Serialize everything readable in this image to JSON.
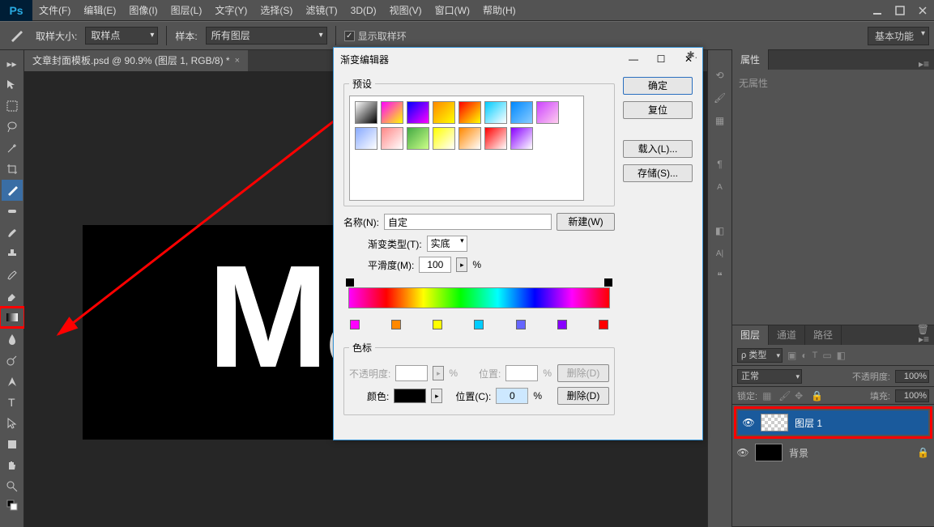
{
  "app": {
    "logo": "Ps"
  },
  "menu": [
    "文件(F)",
    "编辑(E)",
    "图像(I)",
    "图层(L)",
    "文字(Y)",
    "选择(S)",
    "滤镜(T)",
    "3D(D)",
    "视图(V)",
    "窗口(W)",
    "帮助(H)"
  ],
  "optbar": {
    "sample_size_label": "取样大小:",
    "sample_size_value": "取样点",
    "sample_label": "样本:",
    "sample_value": "所有图层",
    "show_ring_label": "显示取样环"
  },
  "workspace": "基本功能",
  "doc_tab": "文章封面模板.psd @ 90.9% (图层 1, RGB/8) *",
  "canvas_text": "Ma",
  "properties_panel": {
    "tab": "属性",
    "body": "无属性"
  },
  "layers_panel": {
    "tabs": [
      "图层",
      "通道",
      "路径"
    ],
    "kind": "ρ 类型",
    "blend": "正常",
    "opacity_label": "不透明度:",
    "opacity_value": "100%",
    "lock_label": "锁定:",
    "fill_label": "填充:",
    "fill_value": "100%",
    "layers": [
      {
        "name": "图层 1",
        "selected": true,
        "thumb": "checker"
      },
      {
        "name": "背景",
        "selected": false,
        "thumb": "black",
        "locked": true
      }
    ]
  },
  "dialog": {
    "title": "渐变编辑器",
    "presets_label": "预设",
    "ok": "确定",
    "reset": "复位",
    "load": "载入(L)...",
    "save": "存储(S)...",
    "name_label": "名称(N):",
    "name_value": "自定",
    "new_btn": "新建(W)",
    "grad_type_label": "渐变类型(T):",
    "grad_type_value": "实底",
    "smooth_label": "平滑度(M):",
    "smooth_value": "100",
    "pct": "%",
    "stops_label": "色标",
    "opacity_label": "不透明度:",
    "position_label": "位置:",
    "position2_label": "位置(C):",
    "position2_value": "0",
    "delete_btn": "删除(D)",
    "color_label": "颜色:",
    "swatches": [
      "linear-gradient(135deg,#fff,#000)",
      "linear-gradient(135deg,#f0f,#ff0)",
      "linear-gradient(135deg,#00f,#f0f)",
      "linear-gradient(135deg,#f80,#ff0)",
      "linear-gradient(135deg,#f00,#ff0)",
      "linear-gradient(135deg,#0cf,#fff)",
      "linear-gradient(135deg,#08f,#8cf)",
      "linear-gradient(135deg,#c4f,#fce)",
      "linear-gradient(135deg,#8af,#fff)",
      "linear-gradient(135deg,#f88,#fff)",
      "linear-gradient(135deg,#4a4,#cf8)",
      "linear-gradient(135deg,#ff0,#fff)",
      "linear-gradient(135deg,#f80,#fff)",
      "linear-gradient(135deg,#f00,#fff)",
      "linear-gradient(135deg,#80f,#fff)"
    ],
    "stop_colors": [
      "#f0f",
      "#f80",
      "#ff0",
      "#0cf",
      "#66f",
      "#80f",
      "#f00"
    ]
  }
}
